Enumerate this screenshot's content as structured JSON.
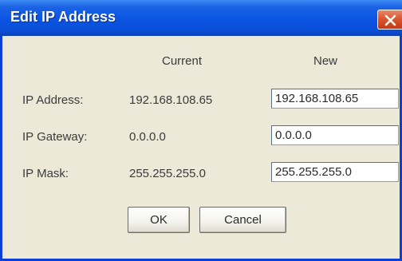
{
  "window": {
    "title": "Edit IP Address",
    "close_icon": "close-icon"
  },
  "columns": {
    "current": "Current",
    "new": "New"
  },
  "rows": [
    {
      "label": "IP Address:",
      "current": "192.168.108.65",
      "new": "192.168.108.65"
    },
    {
      "label": "IP Gateway:",
      "current": "0.0.0.0",
      "new": "0.0.0.0"
    },
    {
      "label": "IP Mask:",
      "current": "255.255.255.0",
      "new": "255.255.255.0"
    }
  ],
  "buttons": {
    "ok": "OK",
    "cancel": "Cancel"
  },
  "colors": {
    "titlebar": "#0a54e3",
    "close": "#d8532c",
    "dialog_bg": "#ece9d8"
  }
}
